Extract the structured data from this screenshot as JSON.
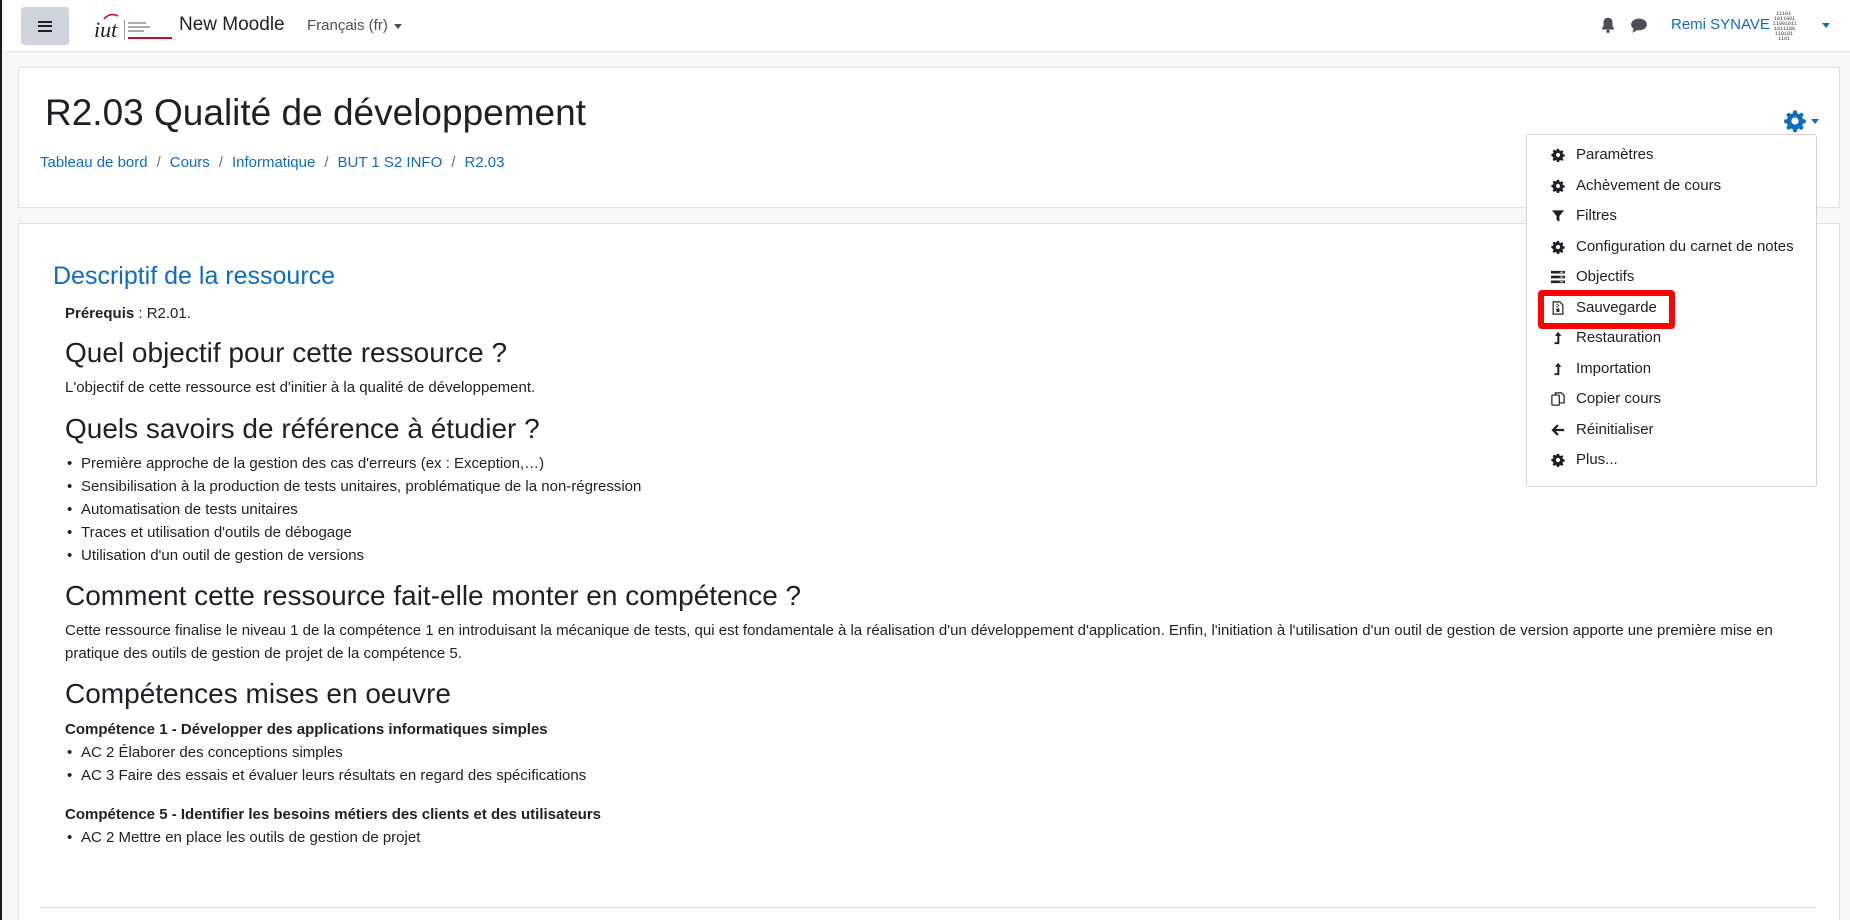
{
  "navbar": {
    "site_name": "New Moodle",
    "language": "Français (fr)",
    "user_name": "Remi SYNAVE",
    "icons": [
      "menu-icon",
      "bell-icon",
      "chat-bubble-icon",
      "avatar-icon",
      "chevron-down-icon"
    ]
  },
  "header": {
    "course_title": "R2.03 Qualité de développement",
    "breadcrumb": [
      "Tableau de bord",
      "Cours",
      "Informatique",
      "BUT 1 S2 INFO",
      "R2.03"
    ],
    "separator": "/"
  },
  "main": {
    "section_title": "Descriptif de la ressource",
    "prereq_label": "Prérequis",
    "prereq_value": " : R2.01.",
    "h_objective": "Quel objectif pour cette ressource ?",
    "objective_text": "L'objectif de cette ressource est d'initier à la qualité de développement.",
    "h_savoirs": "Quels savoirs de référence à étudier ?",
    "savoirs": [
      "Première approche de la gestion des cas d'erreurs (ex : Exception,…)",
      "Sensibilisation à la production de tests unitaires, problématique de la non-régression",
      "Automatisation de tests unitaires",
      "Traces et utilisation d'outils de débogage",
      "Utilisation d'un outil de gestion de versions"
    ],
    "h_competence": "Comment cette ressource fait-elle monter en compétence ?",
    "competence_text": "Cette ressource finalise le niveau 1 de la compétence 1 en introduisant la mécanique de tests, qui est fondamentale à la réalisation d'un développement d'application. Enfin, l'initiation à l'utilisation d'un outil de gestion de version apporte une première mise en pratique des outils de gestion de projet de la compétence 5.",
    "h_mises": "Compétences mises en oeuvre",
    "comp1_title": "Compétence 1 - Développer des applications informatiques simples",
    "comp1_items": [
      "AC 2 Élaborer des conceptions simples",
      "AC 3 Faire des essais et évaluer leurs résultats en regard des spécifications"
    ],
    "comp5_title": "Compétence 5 - Identifier les besoins métiers des clients et des utilisateurs",
    "comp5_items": [
      "AC 2 Mettre en place les outils de gestion de projet"
    ]
  },
  "menu": {
    "items": [
      {
        "label": "Paramètres",
        "icon": "gear-icon"
      },
      {
        "label": "Achèvement de cours",
        "icon": "gear-icon"
      },
      {
        "label": "Filtres",
        "icon": "filter-icon"
      },
      {
        "label": "Configuration du carnet de notes",
        "icon": "gear-icon"
      },
      {
        "label": "Objectifs",
        "icon": "list-icon"
      },
      {
        "label": "Sauvegarde",
        "icon": "file-archive-icon"
      },
      {
        "label": "Restauration",
        "icon": "level-up-icon"
      },
      {
        "label": "Importation",
        "icon": "level-up-icon"
      },
      {
        "label": "Copier cours",
        "icon": "copy-icon"
      },
      {
        "label": "Réinitialiser",
        "icon": "arrow-left-icon"
      },
      {
        "label": "Plus...",
        "icon": "gear-icon"
      }
    ],
    "highlighted": "Sauvegarde",
    "highlight_color": "#ff0000"
  },
  "colors": {
    "link": "#0f6cbf",
    "text": "#1d2125",
    "background": "#f7f7f7"
  }
}
